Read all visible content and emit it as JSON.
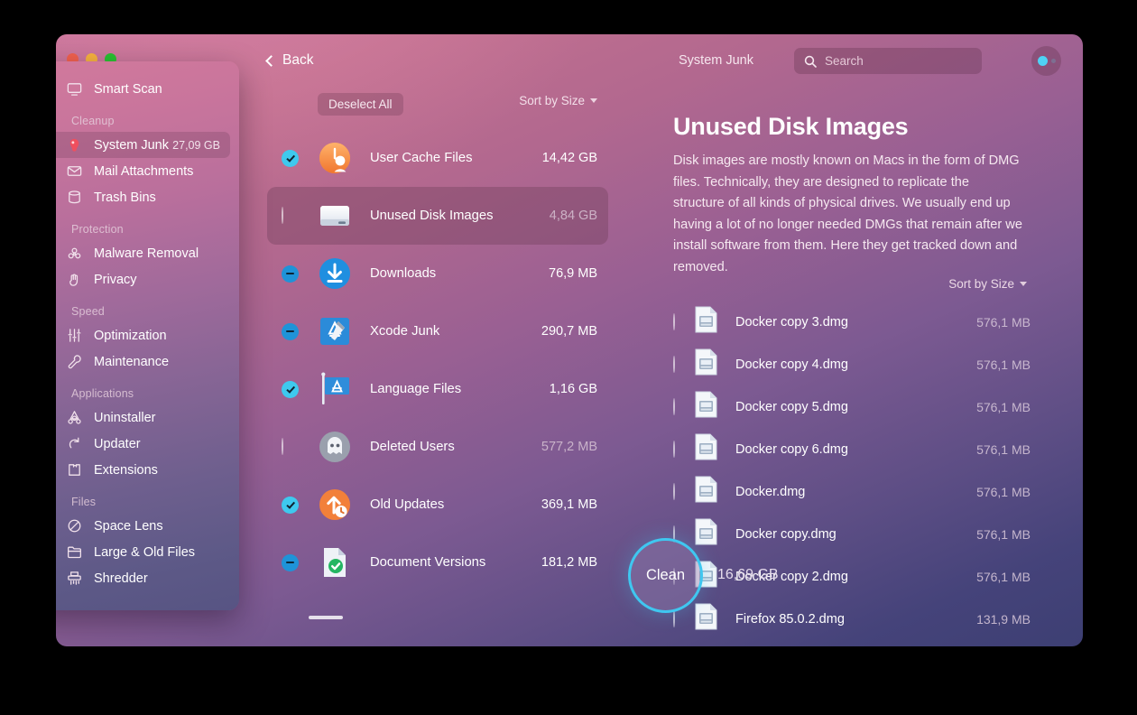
{
  "window": {
    "titlebar_title": "System Junk",
    "back_label": "Back",
    "traffic_lights": [
      "close",
      "minimize",
      "zoom"
    ]
  },
  "search": {
    "placeholder": "Search",
    "value": "",
    "icon": "search-icon"
  },
  "account_button": {
    "icon": "account-status-icon"
  },
  "sidebar": {
    "top_items": [
      {
        "label": "Smart Scan",
        "icon": "smart-scan-icon",
        "size": "",
        "active": false
      }
    ],
    "groups": [
      {
        "label": "Cleanup",
        "items": [
          {
            "label": "System Junk",
            "icon": "system-junk-icon",
            "size": "27,09 GB",
            "active": true
          },
          {
            "label": "Mail Attachments",
            "icon": "mail-icon",
            "size": "",
            "active": false
          },
          {
            "label": "Trash Bins",
            "icon": "trash-bin-icon",
            "size": "",
            "active": false
          }
        ]
      },
      {
        "label": "Protection",
        "items": [
          {
            "label": "Malware Removal",
            "icon": "biohazard-icon",
            "size": "",
            "active": false
          },
          {
            "label": "Privacy",
            "icon": "hand-icon",
            "size": "",
            "active": false
          }
        ]
      },
      {
        "label": "Speed",
        "items": [
          {
            "label": "Optimization",
            "icon": "sliders-icon",
            "size": "",
            "active": false
          },
          {
            "label": "Maintenance",
            "icon": "wrench-icon",
            "size": "",
            "active": false
          }
        ]
      },
      {
        "label": "Applications",
        "items": [
          {
            "label": "Uninstaller",
            "icon": "uninstaller-icon",
            "size": "",
            "active": false
          },
          {
            "label": "Updater",
            "icon": "updater-icon",
            "size": "",
            "active": false
          },
          {
            "label": "Extensions",
            "icon": "extensions-icon",
            "size": "",
            "active": false
          }
        ]
      },
      {
        "label": "Files",
        "items": [
          {
            "label": "Space Lens",
            "icon": "space-lens-icon",
            "size": "",
            "active": false
          },
          {
            "label": "Large & Old Files",
            "icon": "folder-icon",
            "size": "",
            "active": false
          },
          {
            "label": "Shredder",
            "icon": "shredder-icon",
            "size": "",
            "active": false
          }
        ]
      }
    ]
  },
  "category_panel": {
    "deselect_label": "Deselect All",
    "sort_label": "Sort by Size",
    "rows": [
      {
        "label": "User Cache Files",
        "size": "14,42 GB",
        "check": "on",
        "icon": "user-cache-icon",
        "selected": false
      },
      {
        "label": "Unused Disk Images",
        "size": "4,84 GB",
        "check": "off",
        "icon": "disk-image-icon",
        "selected": true
      },
      {
        "label": "Downloads",
        "size": "76,9 MB",
        "check": "partial",
        "icon": "downloads-icon",
        "selected": false
      },
      {
        "label": "Xcode Junk",
        "size": "290,7 MB",
        "check": "partial",
        "icon": "xcode-icon",
        "selected": false
      },
      {
        "label": "Language Files",
        "size": "1,16 GB",
        "check": "on",
        "icon": "language-files-icon",
        "selected": false
      },
      {
        "label": "Deleted Users",
        "size": "577,2 MB",
        "check": "off",
        "icon": "deleted-users-icon",
        "selected": false
      },
      {
        "label": "Old Updates",
        "size": "369,1 MB",
        "check": "on",
        "icon": "old-updates-icon",
        "selected": false
      },
      {
        "label": "Document Versions",
        "size": "181,2 MB",
        "check": "partial",
        "icon": "document-versions-icon",
        "selected": false
      }
    ]
  },
  "detail_panel": {
    "title": "Unused Disk Images",
    "description": "Disk images are mostly known on Macs in the form of DMG files. Technically, they are designed to replicate the structure of all kinds of physical drives. We usually end up having a lot of no longer needed DMGs that remain after we install software from them. Here they get tracked down and removed.",
    "sort_label": "Sort by Size",
    "files": [
      {
        "name": "Docker copy 3.dmg",
        "size": "576,1 MB",
        "check": "off",
        "icon": "dmg-file-icon"
      },
      {
        "name": "Docker copy 4.dmg",
        "size": "576,1 MB",
        "check": "off",
        "icon": "dmg-file-icon"
      },
      {
        "name": "Docker copy 5.dmg",
        "size": "576,1 MB",
        "check": "off",
        "icon": "dmg-file-icon"
      },
      {
        "name": "Docker copy 6.dmg",
        "size": "576,1 MB",
        "check": "off",
        "icon": "dmg-file-icon"
      },
      {
        "name": "Docker.dmg",
        "size": "576,1 MB",
        "check": "off",
        "icon": "dmg-file-icon"
      },
      {
        "name": "Docker copy.dmg",
        "size": "576,1 MB",
        "check": "off",
        "icon": "dmg-file-icon"
      },
      {
        "name": "Docker copy 2.dmg",
        "size": "576,1 MB",
        "check": "off",
        "icon": "dmg-file-icon"
      },
      {
        "name": "Firefox 85.0.2.dmg",
        "size": "131,9 MB",
        "check": "off",
        "icon": "dmg-file-icon"
      }
    ]
  },
  "action_bar": {
    "clean_label": "Clean",
    "total_size": "16,69 GB"
  },
  "colors": {
    "accent_cyan": "#3fc7f0",
    "checkbox_on": "#3ec9ee",
    "checkbox_partial": "#1f93d8",
    "window_top": "#c9749a",
    "window_bottom": "#3d3f73"
  }
}
